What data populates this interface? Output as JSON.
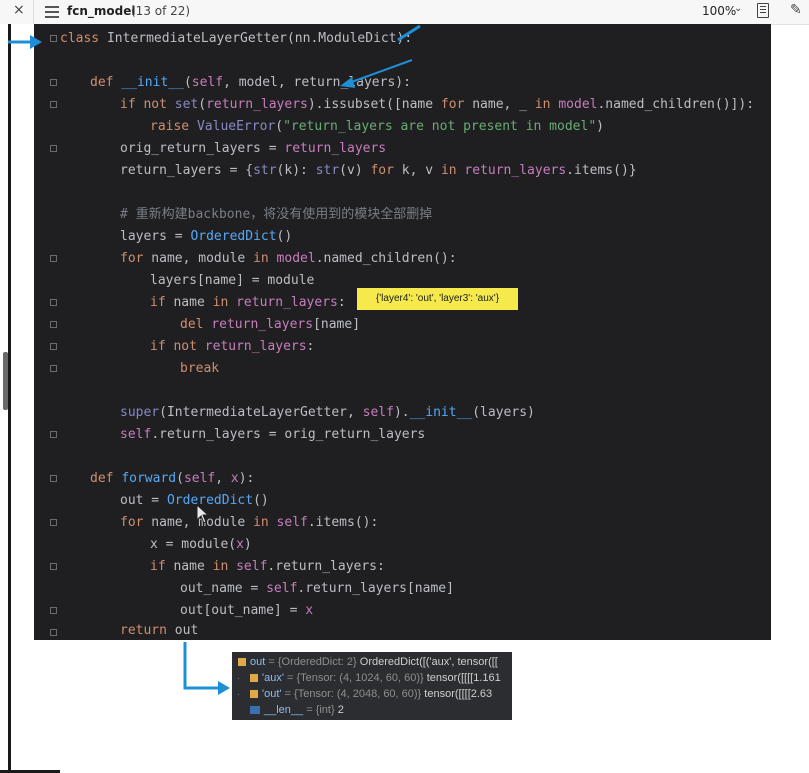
{
  "topbar": {
    "close_label": "×",
    "title": "fcn_model",
    "count": "(13 of 22)",
    "zoom": "100%",
    "chevron": "⌄",
    "pen": "✎"
  },
  "code": {
    "line1": [
      "class",
      " IntermediateLayerGetter(nn.ModuleDict):"
    ],
    "line2": [
      "def",
      " ",
      "__init__",
      "(",
      "self",
      ", ",
      "model",
      ", ",
      "return_layers",
      "):"
    ],
    "line3": [
      "if not ",
      "set",
      "(",
      "return_layers",
      ").issubset([name ",
      "for",
      " name, _ ",
      "in",
      " ",
      "model",
      ".named_children()]):"
    ],
    "line4": [
      "raise ",
      "ValueError",
      "(",
      "\"return_layers are not present in model\"",
      ")"
    ],
    "line5": [
      "orig_return_layers = ",
      "return_layers"
    ],
    "line6": [
      "return_layers = {",
      "str",
      "(k): ",
      "str",
      "(v) ",
      "for",
      " k, v ",
      "in",
      " ",
      "return_layers",
      ".items()}"
    ],
    "line7": [
      "# 重新构建backbone，将没有使用到的模块全部删掉"
    ],
    "line8": [
      "layers = ",
      "OrderedDict",
      "()"
    ],
    "line9": [
      "for",
      " name, module ",
      "in",
      " ",
      "model",
      ".named_children():"
    ],
    "line10": [
      "layers[name] = module"
    ],
    "line11": [
      "if",
      " name ",
      "in",
      " ",
      "return_layers",
      ":"
    ],
    "line12": [
      "del",
      " ",
      "return_layers",
      "[name]"
    ],
    "line13": [
      "if not",
      " ",
      "return_layers",
      ":"
    ],
    "line14": [
      "break"
    ],
    "line15": [
      "super",
      "(IntermediateLayerGetter, ",
      "self",
      ").",
      "__init__",
      "(layers)"
    ],
    "line16": [
      "self",
      ".return_layers = orig_return_layers"
    ],
    "line17": [
      "def",
      " ",
      "forward",
      "(",
      "self",
      ", ",
      "x",
      "):"
    ],
    "line18": [
      "out = ",
      "OrderedDict",
      "()"
    ],
    "line19": [
      "for",
      " name, module ",
      "in",
      " ",
      "self",
      ".items():"
    ],
    "line20": [
      "x = module(",
      "x",
      ")"
    ],
    "line21": [
      "if",
      " name ",
      "in",
      " ",
      "self",
      ".return_layers:"
    ],
    "line22": [
      "out_name = ",
      "self",
      ".return_layers[name]"
    ],
    "line23": [
      "out[out_name] = ",
      "x"
    ],
    "line24": [
      "return",
      " out"
    ]
  },
  "tooltip": "{'layer4': 'out', 'layer3': 'aux'}",
  "debug": {
    "row1": {
      "name": "out",
      "meta": " = {OrderedDict: 2} ",
      "value": "OrderedDict([('aux', tensor([["
    },
    "row2": {
      "chevron": "›",
      "name": "'aux'",
      "meta": " = {Tensor: (4, 1024, 60, 60)} ",
      "value": "tensor([[[[1.161"
    },
    "row3": {
      "chevron": "›",
      "name": "'out'",
      "meta": " = {Tensor: (4, 2048, 60, 60)} ",
      "value": "tensor([[[[2.63"
    },
    "row4": {
      "name": "__len__",
      "meta": " = {int} ",
      "value": "2"
    }
  },
  "colors": {
    "editor_bg": "#1f1f22",
    "keyword": "#cf8e6d",
    "function": "#56a8f5",
    "param": "#c77dbb",
    "string": "#6aab73",
    "comment": "#7a7e85",
    "tooltip_bg": "#f5e94b",
    "arrow": "#1e8fd6"
  }
}
